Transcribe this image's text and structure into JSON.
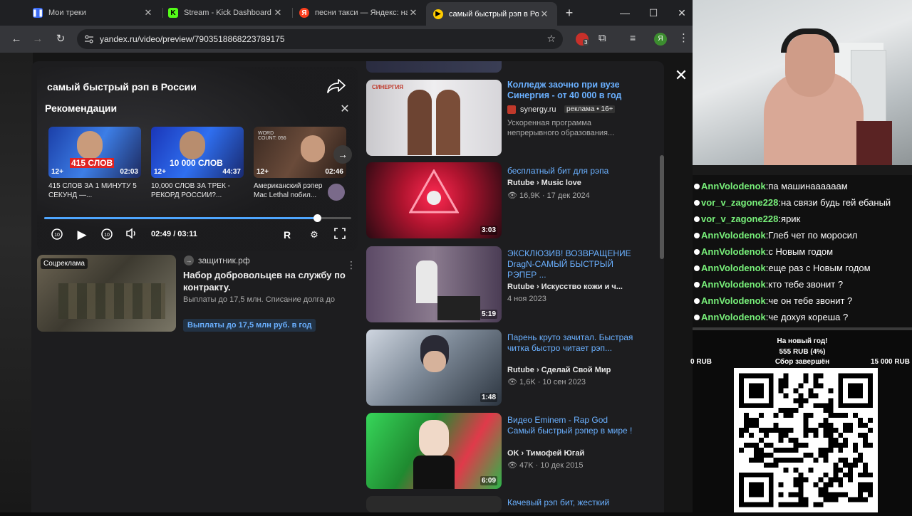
{
  "tabs": [
    {
      "title": "Мои треки",
      "active": false
    },
    {
      "title": "Stream - Kick Dashboard",
      "active": false
    },
    {
      "title": "песни такси — Яндекс: на",
      "active": false
    },
    {
      "title": "самый быстрый рэп в Росс",
      "active": true
    }
  ],
  "address": {
    "url": "yandex.ru/video/preview/7903518868223789175"
  },
  "extensions": {
    "badge": "3",
    "profile_letter": "Я"
  },
  "player": {
    "title": "самый быстрый рэп в России",
    "recommendations_title": "Рекомендации",
    "progress": 0.888,
    "time": "02:49 / 03:11",
    "recs": [
      {
        "caption": "415 СЛОВ ЗА 1 МИНУТУ 5 СЕКУНД —...",
        "overlay": "415 СЛОВ",
        "age": "12+",
        "duration": "02:03"
      },
      {
        "caption": "10,000 СЛОВ ЗА ТРЕК - РЕКОРД РОССИИ?...",
        "overlay": "10 000 СЛОВ",
        "age": "12+",
        "duration": "44:37"
      },
      {
        "caption": "Американский рэпер Mac Lethal побил...",
        "overlay": "WORD COUNT: 056",
        "age": "12+",
        "duration": "02:46"
      }
    ]
  },
  "ad": {
    "badge": "Соцреклама",
    "source": "защитник.рф",
    "title": "Набор добровольцев на службу по контракту.",
    "desc": "Выплаты до 17,5 млн. Списание долга до",
    "cta": "Выплаты до 17,5 млн руб. в год"
  },
  "videos": [
    {
      "title": "Колледж заочно при вузе Синергия - от 40 000 в год",
      "channel": "synergy.ru",
      "tag": "реклама • 16+",
      "meta": "Ускоренная программа непрерывного образования...",
      "duration": "",
      "brand": "СИНЕРГИЯ"
    },
    {
      "title": "бесплатный бит для рэпа",
      "channel": "Rutube › Music love",
      "meta": "16,9K · 17 дек 2024",
      "duration": "3:03"
    },
    {
      "title": "ЭКСКЛЮЗИВ! ВОЗВРАЩЕНИЕ DragN-САМЫЙ БЫСТРЫЙ РЭПЕР ...",
      "channel": "Rutube › Искусство кожи и ч...",
      "meta": "4 ноя 2023",
      "duration": "5:19"
    },
    {
      "title": "Парень круто зачитал. Быстрая читка быстро читает рэп...",
      "channel": "Rutube › Сделай Свой Мир",
      "meta": "1,6K · 10 сен 2023",
      "duration": "1:48"
    },
    {
      "title": "Видео Eminem - Rap God Самый быстрый рэпер в мире !",
      "channel": "OK › Тимофей Югай",
      "meta": "47K · 10 дек 2015",
      "duration": "6:09"
    },
    {
      "title": "Качевый рэп бит, жесткий",
      "channel": "",
      "meta": "",
      "duration": ""
    }
  ],
  "chat": [
    {
      "nick": "AnnVolodenok",
      "msg": "па машинаааааам"
    },
    {
      "nick": "vor_v_zagone228",
      "msg": "на связи будь гей ебаный"
    },
    {
      "nick": "vor_v_zagone228",
      "msg": "ярик"
    },
    {
      "nick": "AnnVolodenok",
      "msg": "Глеб чет по моросил"
    },
    {
      "nick": "AnnVolodenok",
      "msg": "с Новым годом"
    },
    {
      "nick": "AnnVolodenok",
      "msg": "еще раз с Новым годом"
    },
    {
      "nick": "AnnVolodenok",
      "msg": "кто тебе звонит ?"
    },
    {
      "nick": "AnnVolodenok",
      "msg": "че он тебе звонит ?"
    },
    {
      "nick": "AnnVolodenok",
      "msg": "че дохуя кореша ?"
    }
  ],
  "goal": {
    "title": "На новый год!",
    "amount": "555 RUB (4%)",
    "min": "0 RUB",
    "status": "Сбор завершён",
    "max": "15 000 RUB"
  },
  "colors": {
    "link": "#6ab0ff",
    "nick": "#78f07a",
    "accent": "#4ea6ff"
  }
}
